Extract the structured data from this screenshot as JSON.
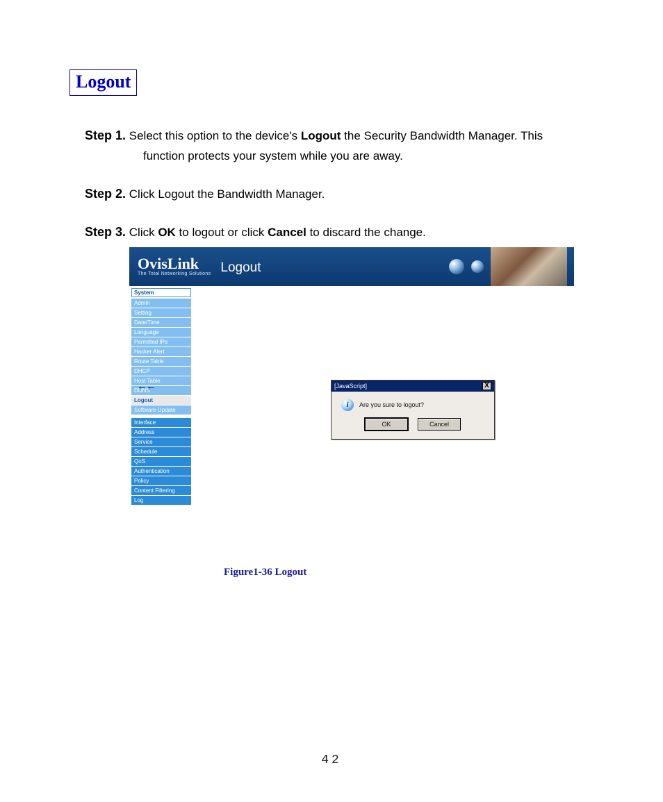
{
  "title": "Logout",
  "steps": [
    {
      "label": "Step 1.",
      "text_parts": [
        "Select this option to the device's ",
        " the Security Bandwidth Manager. This"
      ],
      "bold_inline": "Logout",
      "cont": "function protects your system while you are away."
    },
    {
      "label": "Step 2.",
      "text_parts": [
        "Click Logout the Bandwidth Manager."
      ]
    },
    {
      "label": "Step 3.",
      "text_parts": [
        "Click ",
        " to logout or click ",
        " to discard the change."
      ],
      "bold_inline_1": "OK",
      "bold_inline_2": "Cancel"
    }
  ],
  "figure": {
    "brand": "OvisLink",
    "brand_sub": "The Total Networking Solutions",
    "page_title": "Logout",
    "sidebar_header": "System",
    "sidebar_items_light": [
      "Admin",
      "Setting",
      "Date/Time",
      "Language",
      "Permitted IPs",
      "Hacker Alert",
      "Route Table",
      "DHCP",
      "Host Table",
      "DDNS"
    ],
    "sidebar_logout": "Logout",
    "sidebar_item_last_light": "Software Update",
    "sidebar_items_dark": [
      "Interface",
      "Address",
      "Service",
      "Schedule",
      "QoS",
      "Authentication",
      "Policy",
      "Content Filtering",
      "Log"
    ],
    "arrows": "←←",
    "dialog_title": "[JavaScript]",
    "dialog_close": "X",
    "dialog_text": "Are you sure to logout?",
    "ok_label": "OK",
    "cancel_label": "Cancel"
  },
  "caption": "Figure1-36    Logout",
  "page_number": "42"
}
